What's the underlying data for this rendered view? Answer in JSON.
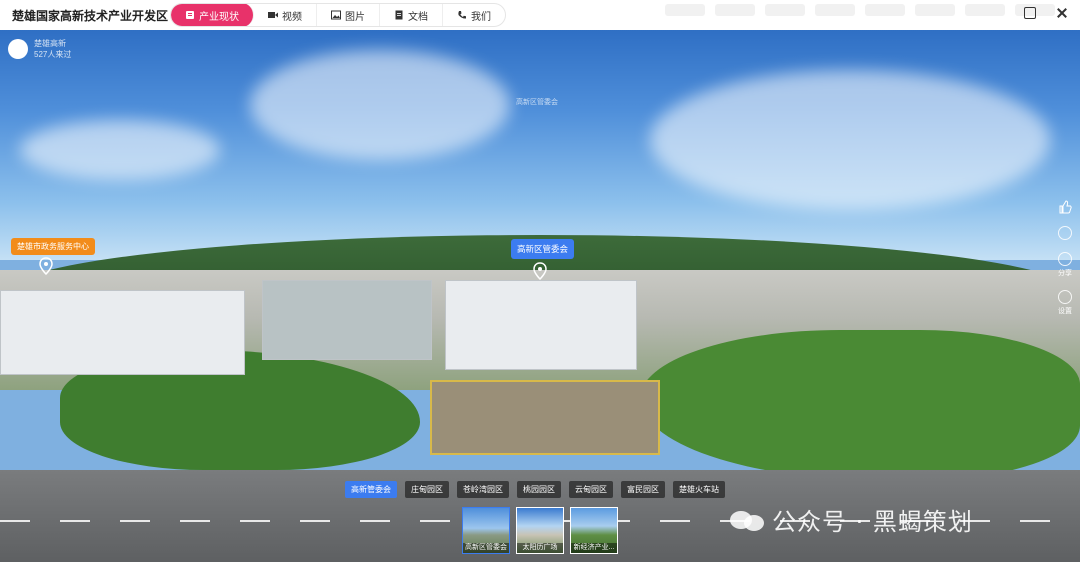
{
  "header": {
    "title": "楚雄国家高新技术产业开发区",
    "nav": [
      {
        "label": "产业现状",
        "icon": "list-icon",
        "active": true
      },
      {
        "label": "视频",
        "icon": "video-icon",
        "active": false
      },
      {
        "label": "图片",
        "icon": "image-icon",
        "active": false
      },
      {
        "label": "文档",
        "icon": "document-icon",
        "active": false
      },
      {
        "label": "我们",
        "icon": "phone-icon",
        "active": false
      }
    ]
  },
  "user": {
    "name": "楚雄高新",
    "views": "527人来过"
  },
  "sky_label": "高新区管委会",
  "hotspots": {
    "left": "楚雄市政务服务中心",
    "center": "高新区管委会"
  },
  "sidebar": {
    "share_label": "分享",
    "more_label": "设置"
  },
  "scenes": [
    {
      "label": "高新管委会",
      "active": true
    },
    {
      "label": "庄甸园区",
      "active": false
    },
    {
      "label": "苍岭湾园区",
      "active": false
    },
    {
      "label": "桃园园区",
      "active": false
    },
    {
      "label": "云甸园区",
      "active": false
    },
    {
      "label": "富民园区",
      "active": false
    },
    {
      "label": "楚雄火车站",
      "active": false
    }
  ],
  "thumbnails": [
    {
      "label": "高新区管委会",
      "active": true
    },
    {
      "label": "太阳历广场",
      "active": false
    },
    {
      "label": "新经济产业...",
      "active": false
    }
  ],
  "watermark": "公众号 · 黑蝎策划",
  "colors": {
    "accent": "#e8326a",
    "hotspot_blue": "#3c7cf0",
    "hotspot_orange": "#f28c1a"
  }
}
